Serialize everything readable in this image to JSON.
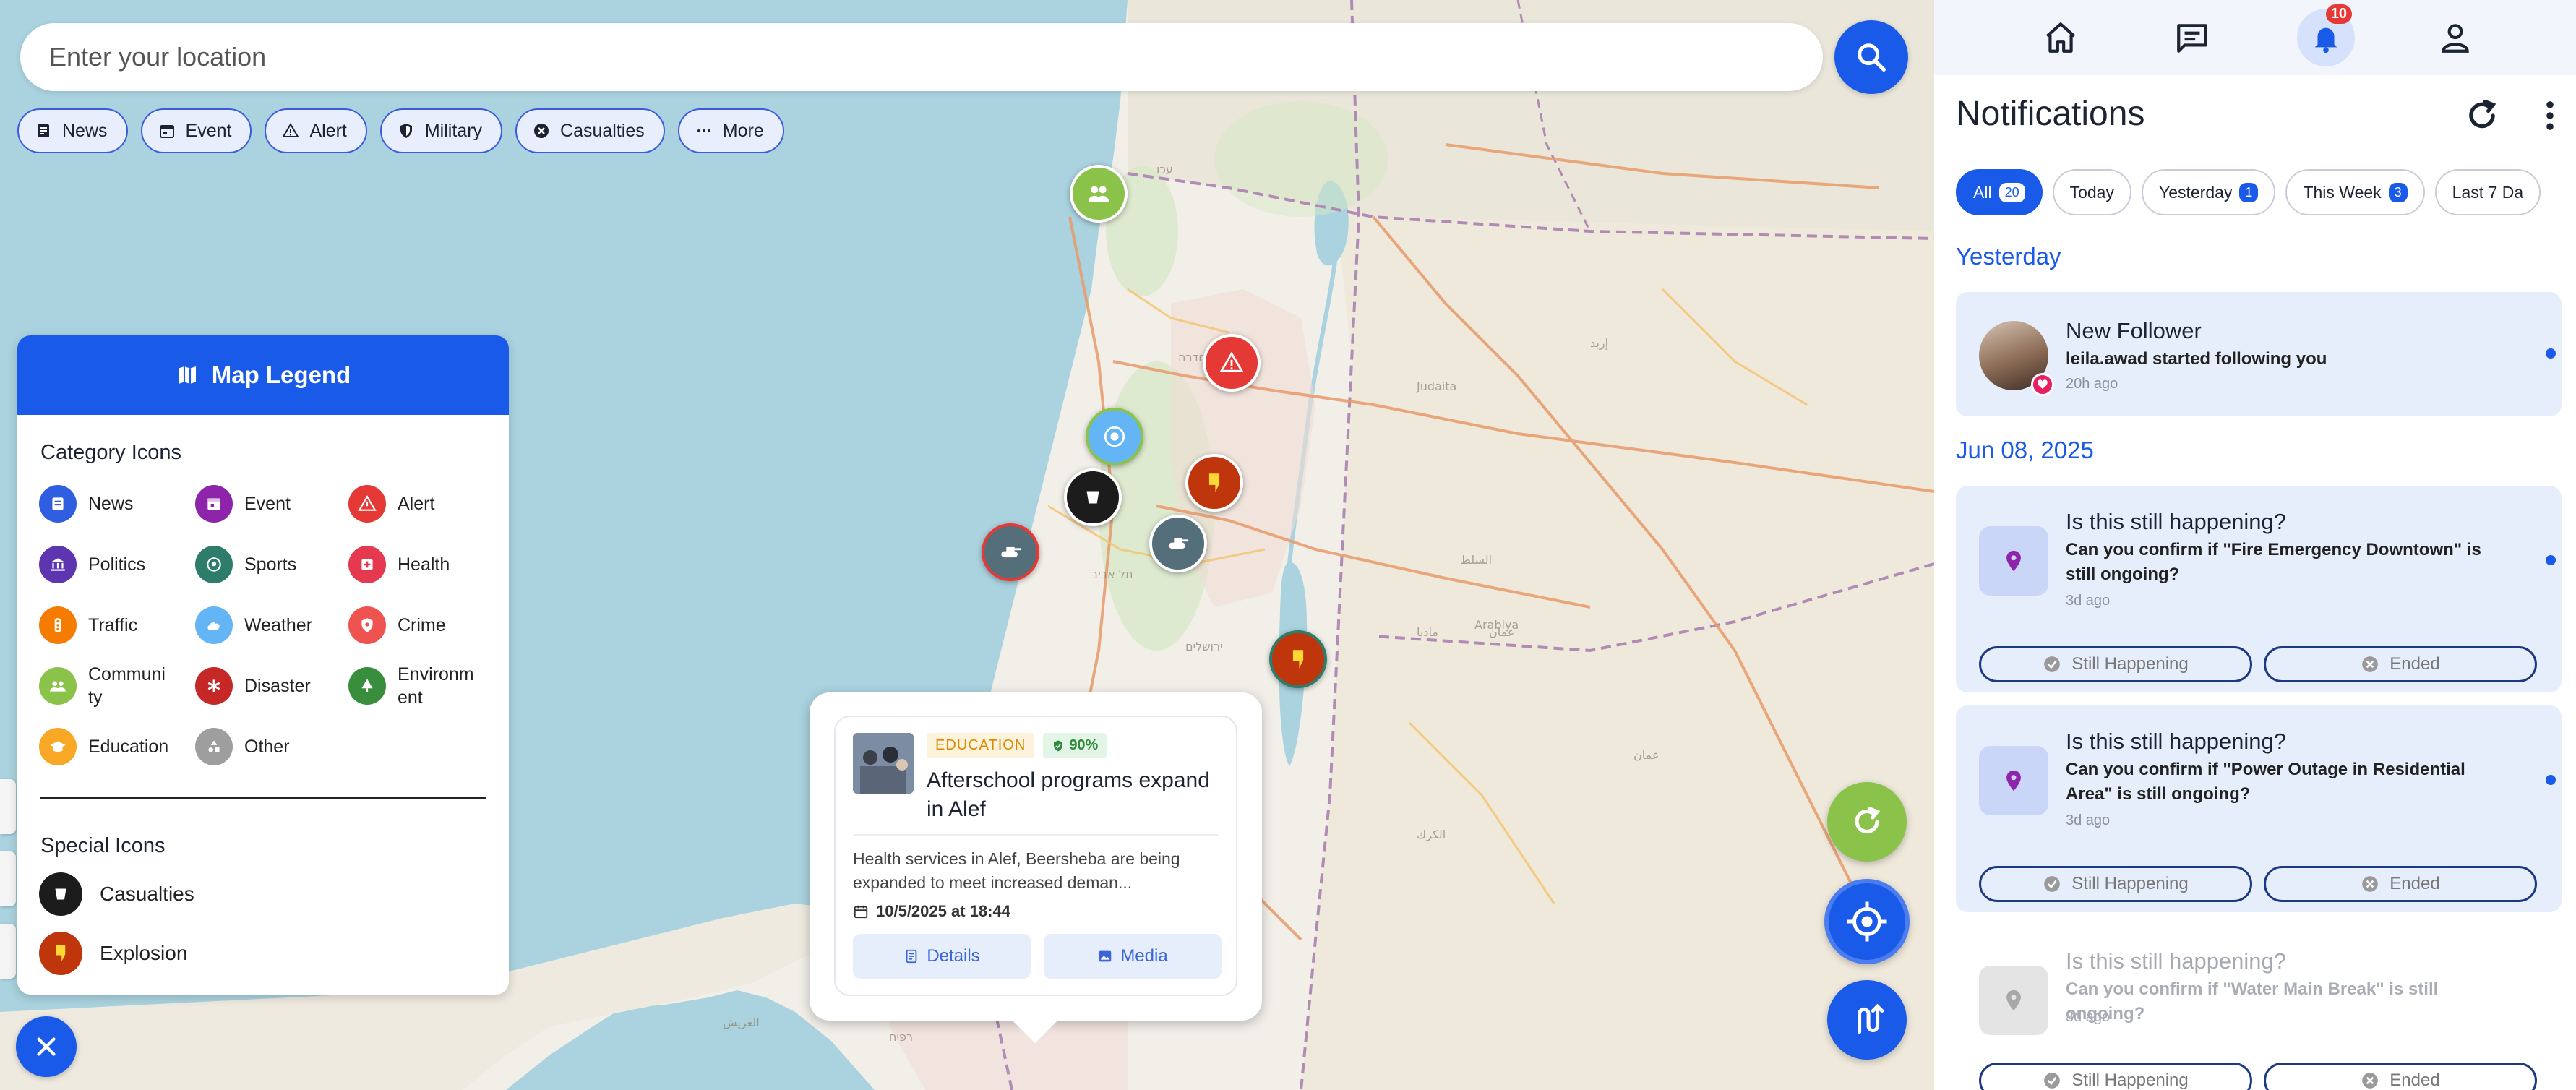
{
  "search": {
    "placeholder": "Enter your location"
  },
  "filters": [
    {
      "label": "News",
      "icon": "newspaper-icon"
    },
    {
      "label": "Event",
      "icon": "calendar-icon"
    },
    {
      "label": "Alert",
      "icon": "warning-icon"
    },
    {
      "label": "Military",
      "icon": "shield-icon"
    },
    {
      "label": "Casualties",
      "icon": "cross-circle-icon"
    },
    {
      "label": "More",
      "icon": "ellipsis-icon"
    }
  ],
  "legend": {
    "title": "Map Legend",
    "category_title": "Category Icons",
    "categories": [
      {
        "label": "News",
        "color": "#2f5fe0"
      },
      {
        "label": "Event",
        "color": "#8e24aa"
      },
      {
        "label": "Alert",
        "color": "#e53935"
      },
      {
        "label": "Politics",
        "color": "#5e35b1"
      },
      {
        "label": "Sports",
        "color": "#2e7d6b"
      },
      {
        "label": "Health",
        "color": "#e53950"
      },
      {
        "label": "Traffic",
        "color": "#f57c00"
      },
      {
        "label": "Weather",
        "color": "#64b5f6"
      },
      {
        "label": "Crime",
        "color": "#ef5350"
      },
      {
        "label": "Communi\nty",
        "color": "#8bc34a"
      },
      {
        "label": "Disaster",
        "color": "#c62828"
      },
      {
        "label": "Environm\nent",
        "color": "#388e3c"
      },
      {
        "label": "Education",
        "color": "#f9a825"
      },
      {
        "label": "Other",
        "color": "#9e9e9e"
      }
    ],
    "special_title": "Special Icons",
    "special": [
      {
        "label": "Casualties",
        "color": "#1c1c1c"
      },
      {
        "label": "Explosion",
        "color": "#bf360c"
      }
    ]
  },
  "popup": {
    "category": "EDUCATION",
    "confidence": "90%",
    "title": "Afterschool programs expand in Alef",
    "description": "Health services in Alef, Beersheba are being expanded to meet increased deman...",
    "date": "10/5/2025 at 18:44",
    "details_label": "Details",
    "media_label": "Media"
  },
  "nav": {
    "notification_count": "10"
  },
  "notifications": {
    "title": "Notifications",
    "tabs": [
      {
        "label": "All",
        "count": "20",
        "active": true
      },
      {
        "label": "Today",
        "count": null,
        "active": false
      },
      {
        "label": "Yesterday",
        "count": "1",
        "active": false
      },
      {
        "label": "This Week",
        "count": "3",
        "active": false
      },
      {
        "label": "Last 7 Da",
        "count": null,
        "active": false
      }
    ],
    "groups": [
      {
        "heading": "Yesterday",
        "items": [
          {
            "title": "New Follower",
            "body": "leila.awad started following you",
            "time": "20h ago"
          }
        ]
      },
      {
        "heading": "Jun 08, 2025",
        "items": [
          {
            "title": "Is this still happening?",
            "body": "Can you confirm if \"Fire Emergency Downtown\" is still ongoing?",
            "time": "3d ago"
          },
          {
            "title": "Is this still happening?",
            "body": "Can you confirm if \"Power Outage in Residential Area\" is still ongoing?",
            "time": "3d ago"
          },
          {
            "title": "Is this still happening?",
            "body": "Can you confirm if \"Water Main Break\" is still ongoing?",
            "time": "3d ago"
          }
        ]
      }
    ],
    "still_label": "Still Happening",
    "ended_label": "Ended"
  }
}
